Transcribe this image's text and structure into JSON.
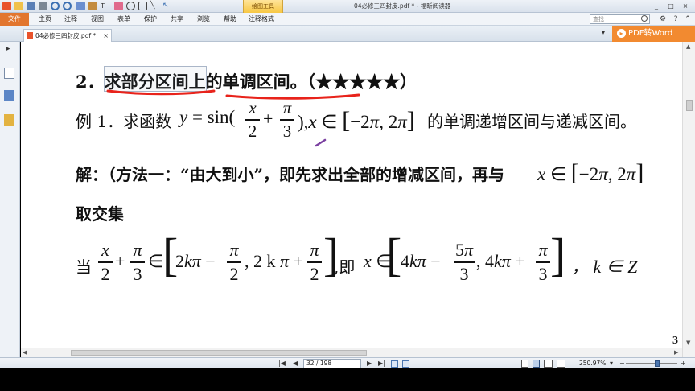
{
  "window": {
    "title": "04必修三四封皮.pdf * - 福昕阅读器",
    "context_tab": "绘图工具",
    "controls": [
      "_",
      "□",
      "×"
    ]
  },
  "ribbon": {
    "file": "文件",
    "tabs": [
      "主页",
      "注释",
      "视图",
      "表单",
      "保护",
      "共享",
      "浏览",
      "帮助",
      "注释格式"
    ],
    "search_placeholder": "查找"
  },
  "doc_tab": {
    "label": "04必修三四封皮.pdf *",
    "close": "×"
  },
  "promo": {
    "label": "PDF转Word",
    "icon": "pdf-convert-icon"
  },
  "content": {
    "heading": "2．求部分区间上的单调区间。（★★★★★）",
    "example_prefix": "例 1．求函数",
    "example_suffix": "的单调递增区间与递减区间。",
    "solution_line1": "解：（方法一：“由大到小”，即先求出全部的增减区间，再与",
    "solution_line2": "取交集",
    "when": "当",
    "ie": ",即",
    "k_in_z": "，  k ∈ Z",
    "page_corner_number": "3"
  },
  "status": {
    "page": "32 / 198",
    "zoom": "250.97%",
    "first": "|◀",
    "prev": "◀",
    "next": "▶",
    "last": "▶|"
  },
  "colors": {
    "accent": "#f28a30",
    "file_menu": "#e2762e",
    "annotation_red": "#e8231b",
    "pen_purple": "#7a3fa0"
  }
}
